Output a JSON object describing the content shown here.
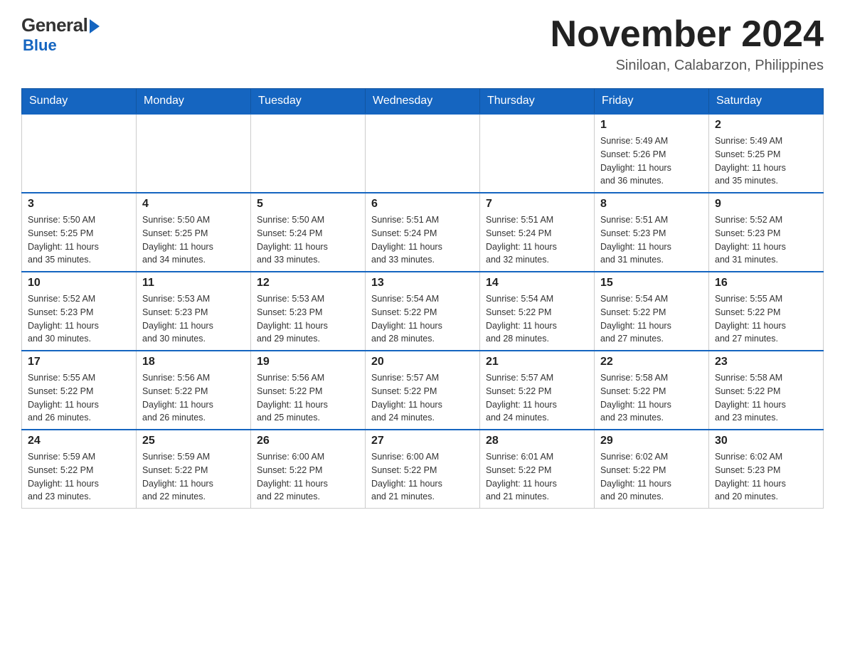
{
  "logo": {
    "general": "General",
    "blue": "Blue"
  },
  "header": {
    "title": "November 2024",
    "location": "Siniloan, Calabarzon, Philippines"
  },
  "weekdays": [
    "Sunday",
    "Monday",
    "Tuesday",
    "Wednesday",
    "Thursday",
    "Friday",
    "Saturday"
  ],
  "weeks": [
    [
      {
        "day": "",
        "info": ""
      },
      {
        "day": "",
        "info": ""
      },
      {
        "day": "",
        "info": ""
      },
      {
        "day": "",
        "info": ""
      },
      {
        "day": "",
        "info": ""
      },
      {
        "day": "1",
        "info": "Sunrise: 5:49 AM\nSunset: 5:26 PM\nDaylight: 11 hours\nand 36 minutes."
      },
      {
        "day": "2",
        "info": "Sunrise: 5:49 AM\nSunset: 5:25 PM\nDaylight: 11 hours\nand 35 minutes."
      }
    ],
    [
      {
        "day": "3",
        "info": "Sunrise: 5:50 AM\nSunset: 5:25 PM\nDaylight: 11 hours\nand 35 minutes."
      },
      {
        "day": "4",
        "info": "Sunrise: 5:50 AM\nSunset: 5:25 PM\nDaylight: 11 hours\nand 34 minutes."
      },
      {
        "day": "5",
        "info": "Sunrise: 5:50 AM\nSunset: 5:24 PM\nDaylight: 11 hours\nand 33 minutes."
      },
      {
        "day": "6",
        "info": "Sunrise: 5:51 AM\nSunset: 5:24 PM\nDaylight: 11 hours\nand 33 minutes."
      },
      {
        "day": "7",
        "info": "Sunrise: 5:51 AM\nSunset: 5:24 PM\nDaylight: 11 hours\nand 32 minutes."
      },
      {
        "day": "8",
        "info": "Sunrise: 5:51 AM\nSunset: 5:23 PM\nDaylight: 11 hours\nand 31 minutes."
      },
      {
        "day": "9",
        "info": "Sunrise: 5:52 AM\nSunset: 5:23 PM\nDaylight: 11 hours\nand 31 minutes."
      }
    ],
    [
      {
        "day": "10",
        "info": "Sunrise: 5:52 AM\nSunset: 5:23 PM\nDaylight: 11 hours\nand 30 minutes."
      },
      {
        "day": "11",
        "info": "Sunrise: 5:53 AM\nSunset: 5:23 PM\nDaylight: 11 hours\nand 30 minutes."
      },
      {
        "day": "12",
        "info": "Sunrise: 5:53 AM\nSunset: 5:23 PM\nDaylight: 11 hours\nand 29 minutes."
      },
      {
        "day": "13",
        "info": "Sunrise: 5:54 AM\nSunset: 5:22 PM\nDaylight: 11 hours\nand 28 minutes."
      },
      {
        "day": "14",
        "info": "Sunrise: 5:54 AM\nSunset: 5:22 PM\nDaylight: 11 hours\nand 28 minutes."
      },
      {
        "day": "15",
        "info": "Sunrise: 5:54 AM\nSunset: 5:22 PM\nDaylight: 11 hours\nand 27 minutes."
      },
      {
        "day": "16",
        "info": "Sunrise: 5:55 AM\nSunset: 5:22 PM\nDaylight: 11 hours\nand 27 minutes."
      }
    ],
    [
      {
        "day": "17",
        "info": "Sunrise: 5:55 AM\nSunset: 5:22 PM\nDaylight: 11 hours\nand 26 minutes."
      },
      {
        "day": "18",
        "info": "Sunrise: 5:56 AM\nSunset: 5:22 PM\nDaylight: 11 hours\nand 26 minutes."
      },
      {
        "day": "19",
        "info": "Sunrise: 5:56 AM\nSunset: 5:22 PM\nDaylight: 11 hours\nand 25 minutes."
      },
      {
        "day": "20",
        "info": "Sunrise: 5:57 AM\nSunset: 5:22 PM\nDaylight: 11 hours\nand 24 minutes."
      },
      {
        "day": "21",
        "info": "Sunrise: 5:57 AM\nSunset: 5:22 PM\nDaylight: 11 hours\nand 24 minutes."
      },
      {
        "day": "22",
        "info": "Sunrise: 5:58 AM\nSunset: 5:22 PM\nDaylight: 11 hours\nand 23 minutes."
      },
      {
        "day": "23",
        "info": "Sunrise: 5:58 AM\nSunset: 5:22 PM\nDaylight: 11 hours\nand 23 minutes."
      }
    ],
    [
      {
        "day": "24",
        "info": "Sunrise: 5:59 AM\nSunset: 5:22 PM\nDaylight: 11 hours\nand 23 minutes."
      },
      {
        "day": "25",
        "info": "Sunrise: 5:59 AM\nSunset: 5:22 PM\nDaylight: 11 hours\nand 22 minutes."
      },
      {
        "day": "26",
        "info": "Sunrise: 6:00 AM\nSunset: 5:22 PM\nDaylight: 11 hours\nand 22 minutes."
      },
      {
        "day": "27",
        "info": "Sunrise: 6:00 AM\nSunset: 5:22 PM\nDaylight: 11 hours\nand 21 minutes."
      },
      {
        "day": "28",
        "info": "Sunrise: 6:01 AM\nSunset: 5:22 PM\nDaylight: 11 hours\nand 21 minutes."
      },
      {
        "day": "29",
        "info": "Sunrise: 6:02 AM\nSunset: 5:22 PM\nDaylight: 11 hours\nand 20 minutes."
      },
      {
        "day": "30",
        "info": "Sunrise: 6:02 AM\nSunset: 5:23 PM\nDaylight: 11 hours\nand 20 minutes."
      }
    ]
  ]
}
